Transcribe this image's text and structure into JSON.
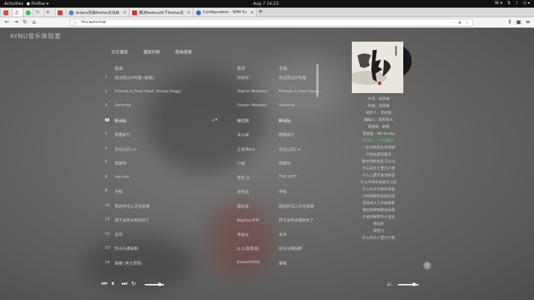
{
  "topbar": {
    "activities": "Activities",
    "app_name": "Firefox",
    "clock": "Aug 7  14:23"
  },
  "browser": {
    "tabs": [
      {
        "title": "",
        "favicon_color": "#d84a4a"
      },
      {
        "title": "",
        "favicon_color": "#3dba4e"
      },
      {
        "title": "YL",
        "favicon_color": "#6b8cc7"
      },
      {
        "title": "A",
        "favicon_color": "#7d7d7d"
      },
      {
        "title": "",
        "favicon_color": "#d04040"
      },
      {
        "title": "fedora安装firefox无法启",
        "favicon_color": "#4a7fd6"
      },
      {
        "title": "解决fedora26下firefox无",
        "favicon_color": "#c8312c"
      },
      {
        "title": "Configuration - RPM Fu",
        "favicon_color": "#3b6fc5"
      }
    ],
    "url_host": "mu.aynu.top",
    "url_scheme": "http://"
  },
  "page": {
    "brand": "AYNU音乐体验室",
    "tabs": [
      "正在播放",
      "播放列表",
      "歌曲搜索"
    ],
    "headers": {
      "song": "歌曲",
      "artist": "歌手",
      "album": "专辑"
    },
    "songs": [
      {
        "num": "1",
        "title": "原谅我当作阿靓 (新版)",
        "artist": "刘和恒",
        "album": "原谅我当作阿靓"
      },
      {
        "num": "2",
        "title": "Friends & Foes (feat. Snoop Dogg)",
        "artist": "Higher Brothers",
        "album": "Friends & Foes (feat..."
      },
      {
        "num": "3",
        "title": "Señorita",
        "artist": "Shawn Mendes",
        "album": "Señorita"
      },
      {
        "num": "▮▮",
        "title": "醉诗仙",
        "artist": "排艺珂",
        "album": "醉诗仙"
      },
      {
        "num": "5",
        "title": "随著前行",
        "artist": "沈以诚",
        "album": "随著前行"
      },
      {
        "num": "6",
        "title": "存在以后1.0",
        "artist": "王者良Est",
        "album": "存在以后1.0"
      },
      {
        "num": "7",
        "title": "我是你",
        "artist": "小绒",
        "album": "我是你"
      },
      {
        "num": "8",
        "title": "me-yan",
        "artist": "李杉 大",
        "album": "THE GIFT"
      },
      {
        "num": "9",
        "title": "学航",
        "artist": "余佳运",
        "album": "学航"
      },
      {
        "num": "10",
        "title": "我这样活入对光英雄",
        "artist": "授纪者",
        "album": "我这样活入对光英雄"
      },
      {
        "num": "11",
        "title": "我不会再去相信你了",
        "artist": "BigYear大年",
        "album": "我不会再去相信你了"
      },
      {
        "num": "12",
        "title": "发呼",
        "artist": "李俊炎",
        "album": "发呼"
      },
      {
        "num": "13",
        "title": "阳光与满街野",
        "artist": "G.G(张思源)",
        "album": "阳光与满街野"
      },
      {
        "num": "14",
        "title": "最暖 (男主货版)",
        "artist": "Eraser8208",
        "album": "最暖"
      }
    ],
    "playing_index": 3,
    "lyrics": [
      "作词：张思楠",
      "作曲：张思楠",
      "制作人：李宗瑞",
      "编曲人：章和和大",
      "录音师：郎郁",
      "录音室：AB Studio",
      "醉诗仙 · 一夜酒醒心",
      "一去不醉风流 听琴醉",
      "不妨女宴饮重举",
      "我与你醉言说 见山山",
      "什么风光十里万户骑",
      "什么上黑千金玉醉酒",
      "什么今世女说来过三回",
      "什么天子与你共举酒",
      "万世就醉知这相远相",
      "把淋说人几天来重新",
      "我在将醉知醉观武相",
      "不如日醉梦中九落天",
      "得在醉",
      "探悟飞",
      "什么风光十里万户骑"
    ],
    "current_lyric_index": 6,
    "progress": 0.75,
    "volume": 0.78
  },
  "colors": {
    "accent": "#45d36a",
    "text": "#d2d2d2"
  }
}
